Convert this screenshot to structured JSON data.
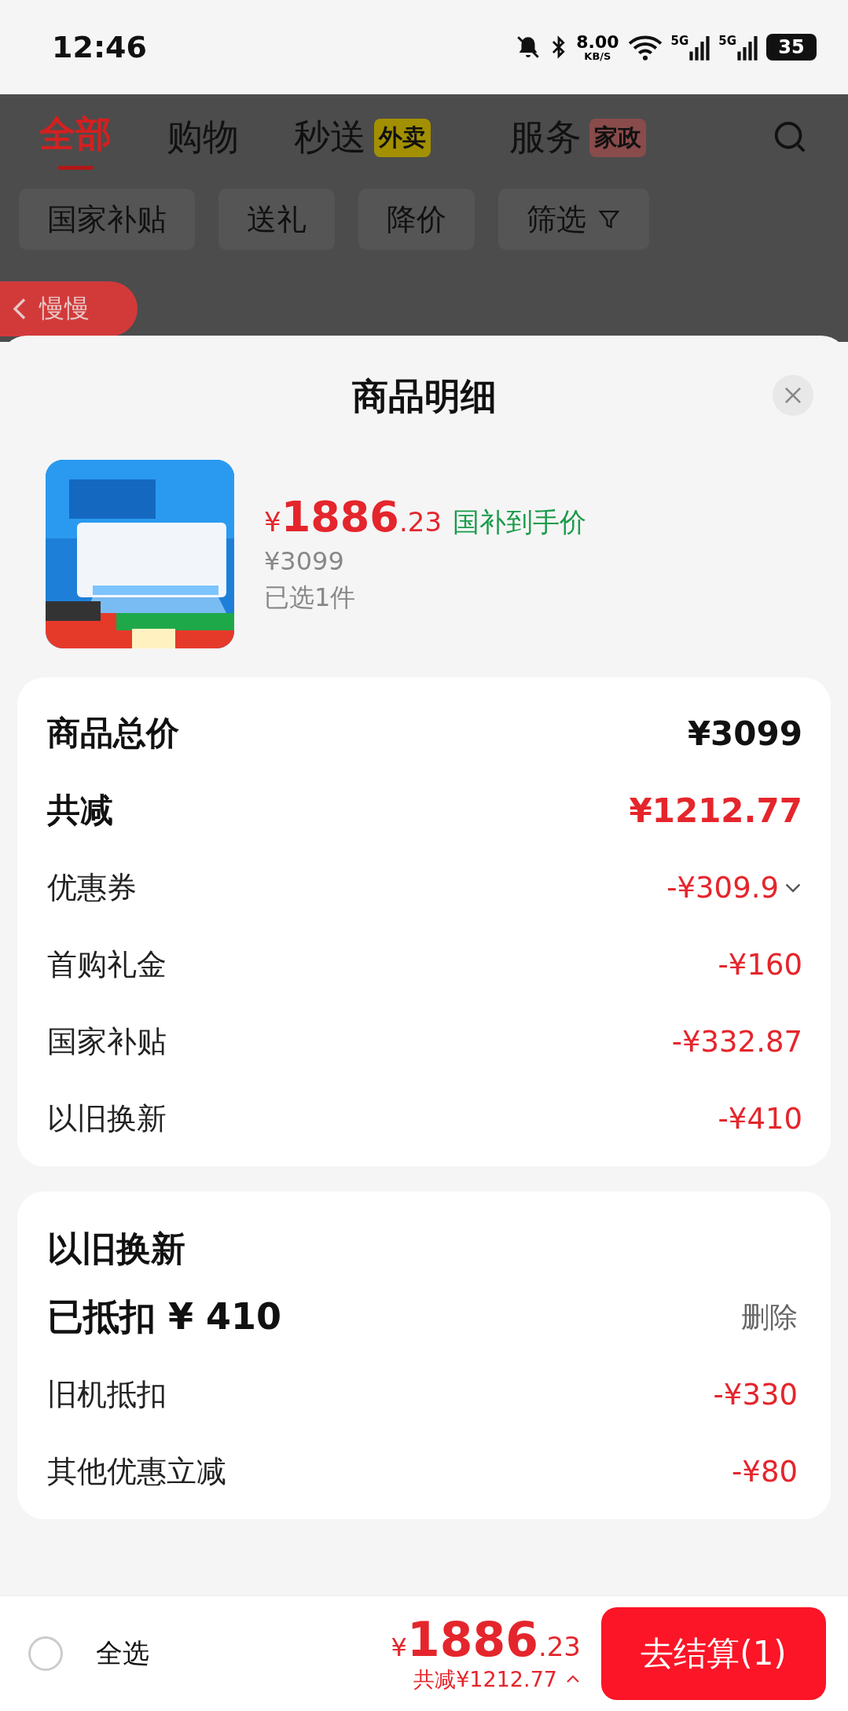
{
  "status_bar": {
    "time": "12:46",
    "net_speed": "8.00",
    "net_unit": "KB/S",
    "signals": [
      "5G",
      "5G"
    ],
    "battery": "35"
  },
  "background_page": {
    "tabs": [
      {
        "label": "全部",
        "selected": true
      },
      {
        "label": "购物",
        "selected": false
      },
      {
        "label": "秒送",
        "selected": false,
        "badge": {
          "text": "外卖",
          "color": "#a39000"
        }
      },
      {
        "label": "服务",
        "selected": false,
        "badge": {
          "text": "家政",
          "color": "#8a4b4b"
        }
      }
    ],
    "chips": [
      {
        "label": "国家补贴",
        "kind": "plain"
      },
      {
        "label": "送礼",
        "kind": "plain"
      },
      {
        "label": "降价",
        "kind": "plain"
      },
      {
        "label": "筛选",
        "kind": "filter"
      }
    ],
    "back_pill": "慢慢"
  },
  "sheet": {
    "title": "商品明细",
    "product": {
      "symbol": "¥",
      "price_int": "1886",
      "price_dec": ".23",
      "price_tag": "国补到手价",
      "original_price": "¥3099",
      "count": "已选1件"
    },
    "summary": [
      {
        "label": "商品总价",
        "value": "¥3099",
        "kind": "total"
      },
      {
        "label": "共减",
        "value": "¥1212.77",
        "kind": "reduction"
      },
      {
        "label": "优惠券",
        "value": "-¥309.9",
        "kind": "dropdown"
      },
      {
        "label": "首购礼金",
        "value": "-¥160",
        "kind": "discount"
      },
      {
        "label": "国家补贴",
        "value": "-¥332.87",
        "kind": "discount"
      },
      {
        "label": "以旧换新",
        "value": "-¥410",
        "kind": "discount"
      }
    ],
    "trade_in": {
      "title": "以旧换新",
      "deducted": "已抵扣 ¥ 410",
      "action": "删除",
      "rows": [
        {
          "label": "旧机抵扣",
          "value": "-¥330"
        },
        {
          "label": "其他优惠立减",
          "value": "-¥80"
        }
      ]
    }
  },
  "bottom_bar": {
    "select_all": {
      "label": "全选",
      "checked": false
    },
    "symbol": "¥",
    "price_int": "1886",
    "price_dec": ".23",
    "saved": "共减¥1212.77",
    "checkout": "去结算(1)"
  }
}
